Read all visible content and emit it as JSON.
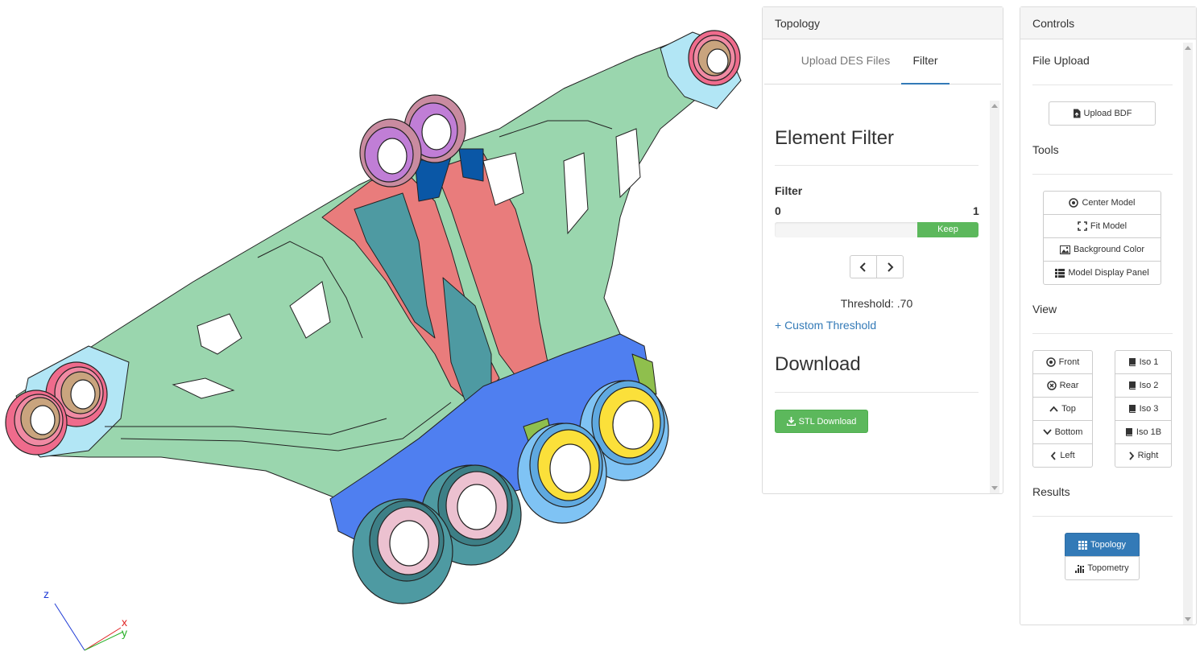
{
  "axes": {
    "x": "x",
    "y": "y",
    "z": "z"
  },
  "topology_panel": {
    "title": "Topology",
    "tabs": [
      "Upload DES Files",
      "Filter"
    ],
    "element_filter_heading": "Element Filter",
    "filter_label": "Filter",
    "slider_min": "0",
    "slider_max": "1",
    "slider_keep_label": "Keep",
    "slider_keep_fraction": 0.3,
    "threshold_text": "Threshold: .70",
    "custom_threshold_link": "+ Custom Threshold",
    "download_heading": "Download",
    "stl_download_label": "STL Download"
  },
  "controls_panel": {
    "title": "Controls",
    "file_upload_title": "File Upload",
    "upload_bdf_label": "Upload BDF",
    "tools_title": "Tools",
    "tools": [
      {
        "label": "Center Model",
        "icon": "target-icon"
      },
      {
        "label": "Fit Model",
        "icon": "fullscreen-icon"
      },
      {
        "label": "Background Color",
        "icon": "picture-icon"
      },
      {
        "label": "Model Display Panel",
        "icon": "list-icon"
      }
    ],
    "view_title": "View",
    "view_left": [
      {
        "label": "Front",
        "icon": "target-icon"
      },
      {
        "label": "Rear",
        "icon": "circle-x-icon"
      },
      {
        "label": "Top",
        "icon": "chevron-up-icon"
      },
      {
        "label": "Bottom",
        "icon": "chevron-down-icon"
      },
      {
        "label": "Left",
        "icon": "chevron-left-icon"
      }
    ],
    "view_right": [
      {
        "label": "Iso 1",
        "icon": "book-icon"
      },
      {
        "label": "Iso 2",
        "icon": "book-icon"
      },
      {
        "label": "Iso 3",
        "icon": "book-icon"
      },
      {
        "label": "Iso 1B",
        "icon": "book-icon"
      },
      {
        "label": "Right",
        "icon": "chevron-right-icon"
      }
    ],
    "results_title": "Results",
    "results": [
      {
        "label": "Topology",
        "icon": "grid-icon",
        "active": true
      },
      {
        "label": "Topometry",
        "icon": "bars-icon",
        "active": false
      }
    ]
  },
  "colors": {
    "green": "#9ad6ae",
    "cyan": "#b2e6f5",
    "pink": "#ef6b8c",
    "tan": "#c9a47e",
    "salmon": "#e97c7c",
    "teal": "#4e9aa2",
    "navy": "#0a57a6",
    "purple": "#c07ed6",
    "mauve": "#c98ba0",
    "blue": "#4f7ff0",
    "yellow": "#fbe03a",
    "lightblue": "#7fc3f4",
    "pale_pink": "#ecc1d0",
    "primary": "#337ab7",
    "success": "#5cb85c"
  }
}
